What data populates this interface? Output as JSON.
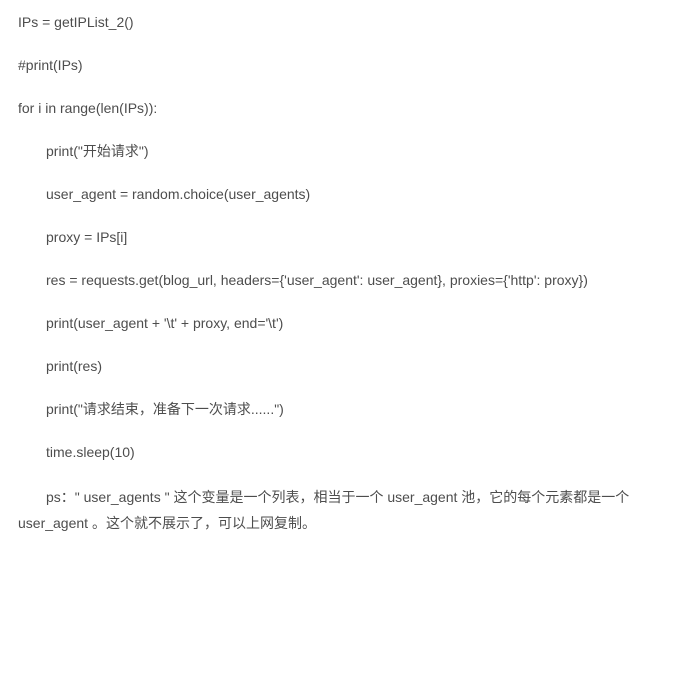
{
  "code": {
    "lines": [
      {
        "text": "IPs = getIPList_2()",
        "indent": false
      },
      {
        "text": "#print(IPs)",
        "indent": false
      },
      {
        "text": "for i in range(len(IPs)):",
        "indent": false
      },
      {
        "text": "print(\"开始请求\")",
        "indent": true
      },
      {
        "text": "user_agent = random.choice(user_agents)",
        "indent": true
      },
      {
        "text": "proxy = IPs[i]",
        "indent": true
      },
      {
        "text": "res = requests.get(blog_url, headers={'user_agent': user_agent}, proxies={'http': proxy})",
        "indent": true,
        "wrap": true
      },
      {
        "text": "print(user_agent + '\\t' + proxy, end='\\t')",
        "indent": true
      },
      {
        "text": "print(res)",
        "indent": true
      },
      {
        "text": "print(\"请求结束，准备下一次请求......\")",
        "indent": true
      },
      {
        "text": "time.sleep(10)",
        "indent": true
      }
    ]
  },
  "note": {
    "text": "ps：\" user_agents \" 这个变量是一个列表，相当于一个 user_agent 池，它的每个元素都是一个 user_agent 。这个就不展示了，可以上网复制。"
  }
}
